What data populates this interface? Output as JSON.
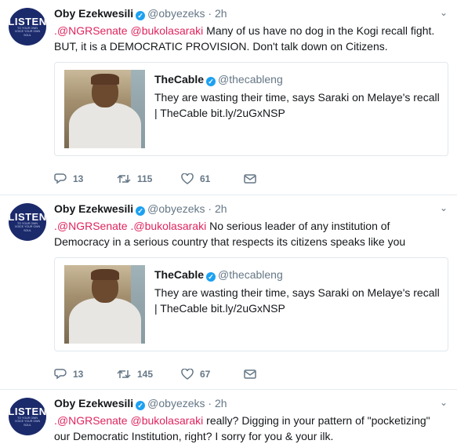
{
  "tweets": [
    {
      "name": "Oby Ezekwesili",
      "handle": "@obyezeks",
      "time": "· 2h",
      "mention1": ".@NGRSenate",
      "mention2": "@bukolasaraki",
      "text": " Many of us have no dog in the Kogi recall fight. BUT, it is a DEMOCRATIC PROVISION. Don't talk down on Citizens.",
      "card": {
        "name": "TheCable",
        "handle": "@thecableng",
        "text": "They are wasting their time, says Saraki on Melaye's recall | TheCable bit.ly/2uGxNSP"
      },
      "replies": "13",
      "retweets": "115",
      "likes": "61"
    },
    {
      "name": "Oby Ezekwesili",
      "handle": "@obyezeks",
      "time": "· 2h",
      "mention1": ".@NGRSenate",
      "mention2": ".@bukolasaraki",
      "text": " No serious leader of any institution of Democracy in a serious country that respects its citizens speaks like you",
      "card": {
        "name": "TheCable",
        "handle": "@thecableng",
        "text": "They are wasting their time, says Saraki on Melaye's recall | TheCable bit.ly/2uGxNSP"
      },
      "replies": "13",
      "retweets": "145",
      "likes": "67"
    },
    {
      "name": "Oby Ezekwesili",
      "handle": "@obyezeks",
      "time": "· 2h",
      "mention1": ".@NGRSenate",
      "mention2": "@bukolasaraki",
      "text": " really?  Digging in your pattern of \"pocketizing\" our Democratic Institution, right? I sorry for you & your ilk."
    }
  ],
  "avatar": {
    "big": "LISTEN",
    "small": "TO YOUR OWN VOICE YOUR OWN SOUL"
  },
  "colors": {
    "mention": "#e0245e",
    "verified": "#1da1f2",
    "avatar_bg": "#1b2a6b",
    "icon": "#657786"
  }
}
